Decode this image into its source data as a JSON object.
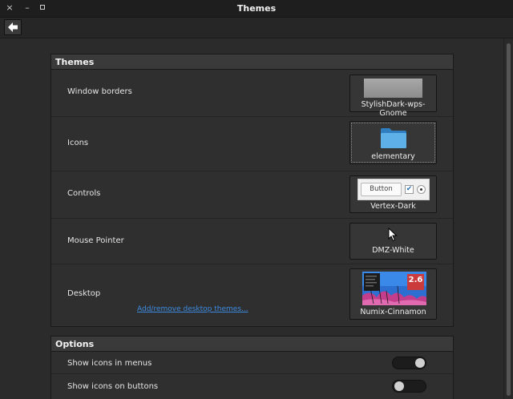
{
  "window": {
    "title": "Themes"
  },
  "titlebar": {
    "close_glyph": "×",
    "min_glyph": "–"
  },
  "toolbar": {
    "back_icon": "back-arrow-icon"
  },
  "themes_section": {
    "header": "Themes",
    "rows": [
      {
        "label": "Window borders",
        "value": "StylishDark-wps-Gnome"
      },
      {
        "label": "Icons",
        "value": "elementary"
      },
      {
        "label": "Controls",
        "value": "Vertex-Dark",
        "preview_button": "Button"
      },
      {
        "label": "Mouse Pointer",
        "value": "DMZ-White"
      },
      {
        "label": "Desktop",
        "value": "Numix-Cinnamon",
        "link": "Add/remove desktop themes...",
        "preview_badge": "2.6"
      }
    ]
  },
  "options_section": {
    "header": "Options",
    "rows": [
      {
        "label": "Show icons in menus",
        "enabled": true
      },
      {
        "label": "Show icons on buttons",
        "enabled": false
      }
    ]
  },
  "colors": {
    "accent": "#3d8be0",
    "background": "#2b2b2b",
    "folder": "#4aa3df"
  }
}
